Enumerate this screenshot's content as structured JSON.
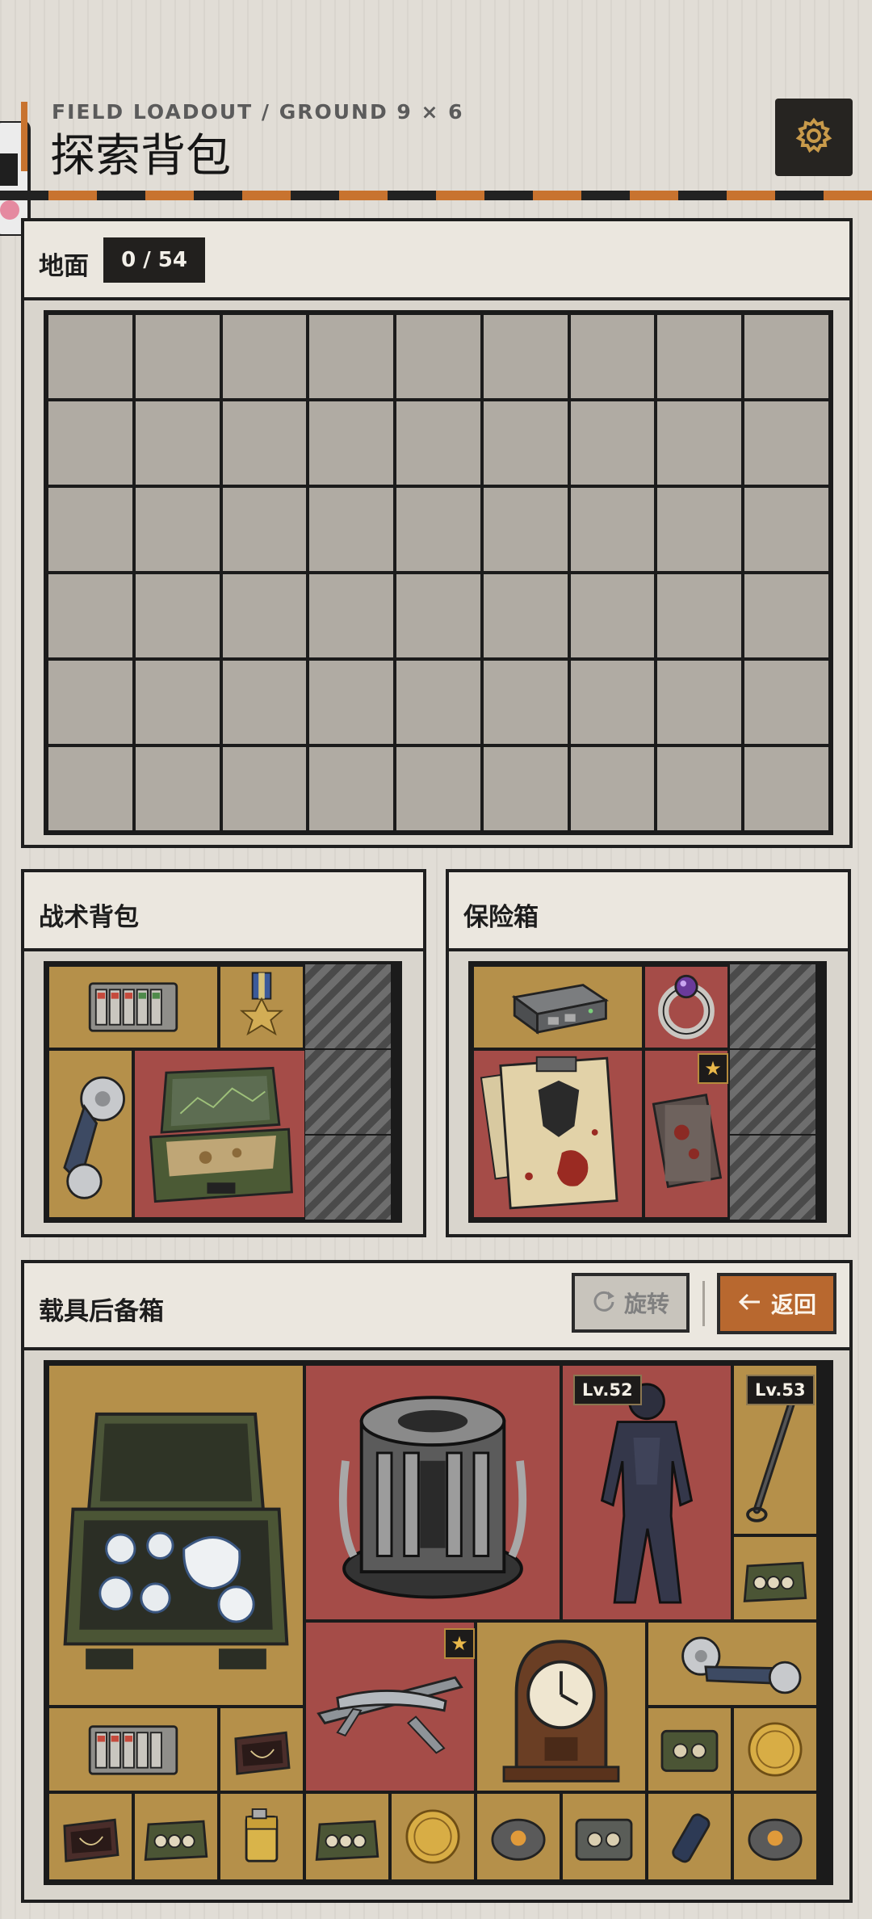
{
  "header": {
    "subtitle": "FIELD LOADOUT / GROUND 9 × 6",
    "title": "探索背包",
    "settings_icon": "gear-icon"
  },
  "mini_program_capsule": {
    "menu_icon": "more-dots-icon",
    "close_icon": "target-close-icon"
  },
  "ground": {
    "title": "地面",
    "count": "0 / 54",
    "cols": 9,
    "rows": 6
  },
  "tactical_backpack": {
    "title": "战术背包",
    "items": [
      {
        "name": "battery-rack",
        "bg": "gold"
      },
      {
        "name": "medal",
        "bg": "gold"
      },
      {
        "name": "duct-tape",
        "bg": "gold"
      },
      {
        "name": "tactical-case-map",
        "bg": "red"
      }
    ]
  },
  "safe_box": {
    "title": "保险箱",
    "items": [
      {
        "name": "network-router",
        "bg": "gold"
      },
      {
        "name": "gem-ring",
        "bg": "red"
      },
      {
        "name": "bloody-documents",
        "bg": "red"
      },
      {
        "name": "occult-card",
        "bg": "red",
        "starred": true
      }
    ]
  },
  "vehicle_trunk": {
    "title": "载具后备箱",
    "rotate_label": "旋转",
    "return_label": "返回",
    "items": [
      {
        "name": "tea-set-case",
        "bg": "gold"
      },
      {
        "name": "reactor-core",
        "bg": "red"
      },
      {
        "name": "stealth-suit",
        "bg": "red",
        "level": "Lv.52"
      },
      {
        "name": "baton",
        "bg": "gold",
        "level": "Lv.53"
      },
      {
        "name": "ammo-case",
        "bg": "gold"
      },
      {
        "name": "recon-drone",
        "bg": "red",
        "starred": true
      },
      {
        "name": "mantel-clock",
        "bg": "gold"
      },
      {
        "name": "duct-tape",
        "bg": "gold"
      },
      {
        "name": "battery-rack",
        "bg": "gold"
      },
      {
        "name": "jewelry-box",
        "bg": "gold"
      },
      {
        "name": "tape-cassette-case",
        "bg": "gold"
      },
      {
        "name": "gold-coin",
        "bg": "gold"
      },
      {
        "name": "jewelry-box",
        "bg": "gold"
      },
      {
        "name": "ammo-case",
        "bg": "gold"
      },
      {
        "name": "zippo-lighter",
        "bg": "gold"
      },
      {
        "name": "ammo-case",
        "bg": "gold"
      },
      {
        "name": "gold-coin",
        "bg": "gold"
      },
      {
        "name": "lantern-device",
        "bg": "gold"
      },
      {
        "name": "tape-cassette-case",
        "bg": "gold"
      },
      {
        "name": "spray-canister",
        "bg": "gold"
      },
      {
        "name": "lantern-device",
        "bg": "gold"
      }
    ]
  },
  "colors": {
    "accent": "#c8732f",
    "slot_gold": "#b5904a",
    "slot_red": "#a54c48",
    "slot_empty": "#b0aba3",
    "dark": "#1b1b1b"
  }
}
